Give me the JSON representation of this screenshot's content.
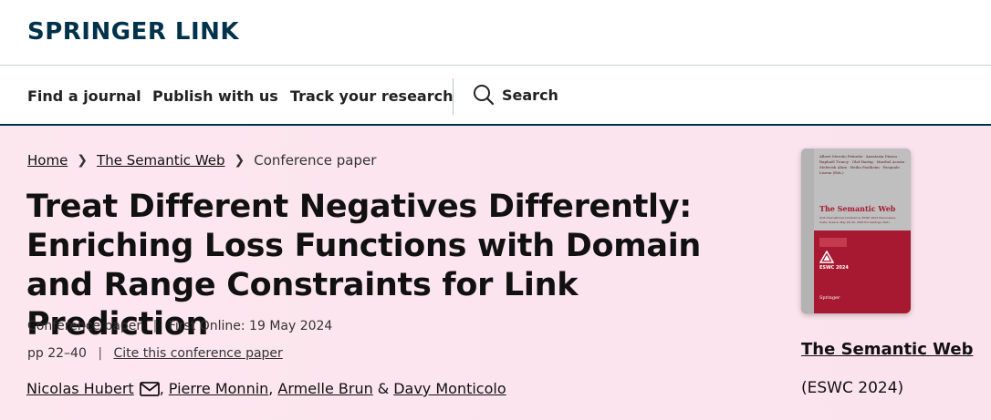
{
  "header": {
    "logo": "SPRINGER LINK"
  },
  "nav": {
    "items": [
      "Find a journal",
      "Publish with us",
      "Track your research"
    ],
    "search_label": "Search"
  },
  "breadcrumb": [
    "Home",
    "The Semantic Web",
    "Conference paper"
  ],
  "paper": {
    "title": "Treat Different Negatives Differently: Enriching Loss Functions with Domain and Range Constraints for Link Prediction",
    "type": "Conference paper",
    "first_online": "First Online: 19 May 2024",
    "pages": "pp 22–40",
    "cite_link": "Cite this conference paper",
    "authors": [
      "Nicolas Hubert",
      "Pierre Monnin",
      "Armelle Brun",
      "Davy Monticolo"
    ],
    "amp": "&"
  },
  "book": {
    "title": "The Semantic Web",
    "subtitle": "(ESWC 2024)",
    "cover": {
      "authors": "Albert Meroño Peñuela · Anastasia Dimou · Raphaël Troncy · Olaf Hartig · Maribel Acosta · Mehwish Alam · Heiko Paulheim · Pasquale Lisena (Eds.)",
      "title": "The Semantic Web",
      "subtitle": "21st International Conference, ESWC 2024 Hersonissos, Crete, Greece, May 26–30, 2024 Proceedings, Part I",
      "series": "LNCS 14664",
      "event_logo_text": "ESWC 2024",
      "publisher": "Springer"
    }
  },
  "colors": {
    "brand": "#01324b",
    "hero_bg": "#fce4ee",
    "cover_red": "#a71931",
    "cover_grey": "#bfbfbf"
  },
  "icons": [
    "search-icon",
    "envelope-icon",
    "chevron-right-icon"
  ]
}
